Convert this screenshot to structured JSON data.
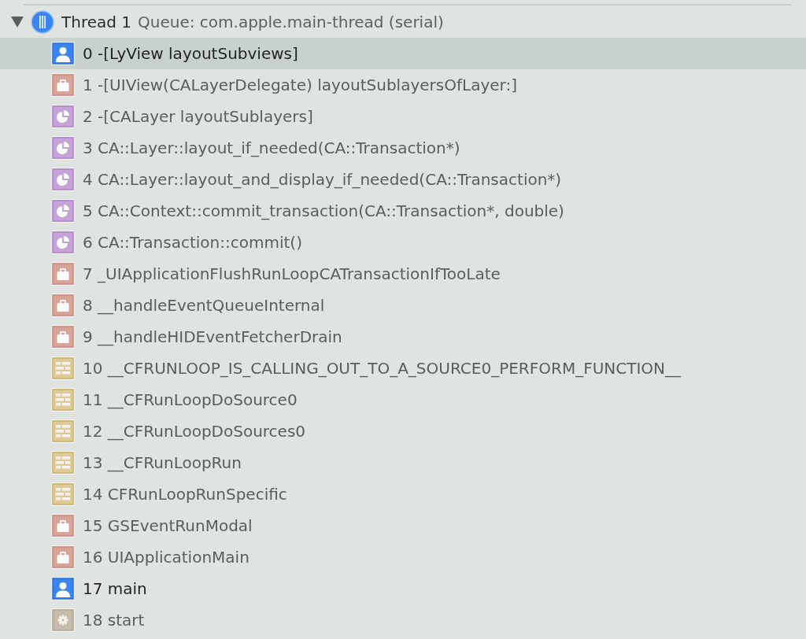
{
  "thread": {
    "title": "Thread 1",
    "queue": "Queue: com.apple.main-thread (serial)",
    "expanded": true
  },
  "frames": [
    {
      "label": "0 -[LyView layoutSubviews]",
      "kind": "user",
      "selected": true
    },
    {
      "label": "1 -[UIView(CALayerDelegate) layoutSublayersOfLayer:]",
      "kind": "uikit",
      "selected": false
    },
    {
      "label": "2 -[CALayer layoutSublayers]",
      "kind": "quartz",
      "selected": false
    },
    {
      "label": "3 CA::Layer::layout_if_needed(CA::Transaction*)",
      "kind": "quartz",
      "selected": false
    },
    {
      "label": "4 CA::Layer::layout_and_display_if_needed(CA::Transaction*)",
      "kind": "quartz",
      "selected": false
    },
    {
      "label": "5 CA::Context::commit_transaction(CA::Transaction*, double)",
      "kind": "quartz",
      "selected": false
    },
    {
      "label": "6 CA::Transaction::commit()",
      "kind": "quartz",
      "selected": false
    },
    {
      "label": "7 _UIApplicationFlushRunLoopCATransactionIfTooLate",
      "kind": "uikit",
      "selected": false
    },
    {
      "label": "8 __handleEventQueueInternal",
      "kind": "uikit",
      "selected": false
    },
    {
      "label": "9 __handleHIDEventFetcherDrain",
      "kind": "uikit",
      "selected": false
    },
    {
      "label": "10 __CFRUNLOOP_IS_CALLING_OUT_TO_A_SOURCE0_PERFORM_FUNCTION__",
      "kind": "foundation",
      "selected": false
    },
    {
      "label": "11 __CFRunLoopDoSource0",
      "kind": "foundation",
      "selected": false
    },
    {
      "label": "12 __CFRunLoopDoSources0",
      "kind": "foundation",
      "selected": false
    },
    {
      "label": "13 __CFRunLoopRun",
      "kind": "foundation",
      "selected": false
    },
    {
      "label": "14 CFRunLoopRunSpecific",
      "kind": "foundation",
      "selected": false
    },
    {
      "label": "15 GSEventRunModal",
      "kind": "uikit",
      "selected": false
    },
    {
      "label": "16 UIApplicationMain",
      "kind": "uikit",
      "selected": false
    },
    {
      "label": "17 main",
      "kind": "user",
      "selected": false
    },
    {
      "label": "18 start",
      "kind": "system",
      "selected": false
    }
  ]
}
